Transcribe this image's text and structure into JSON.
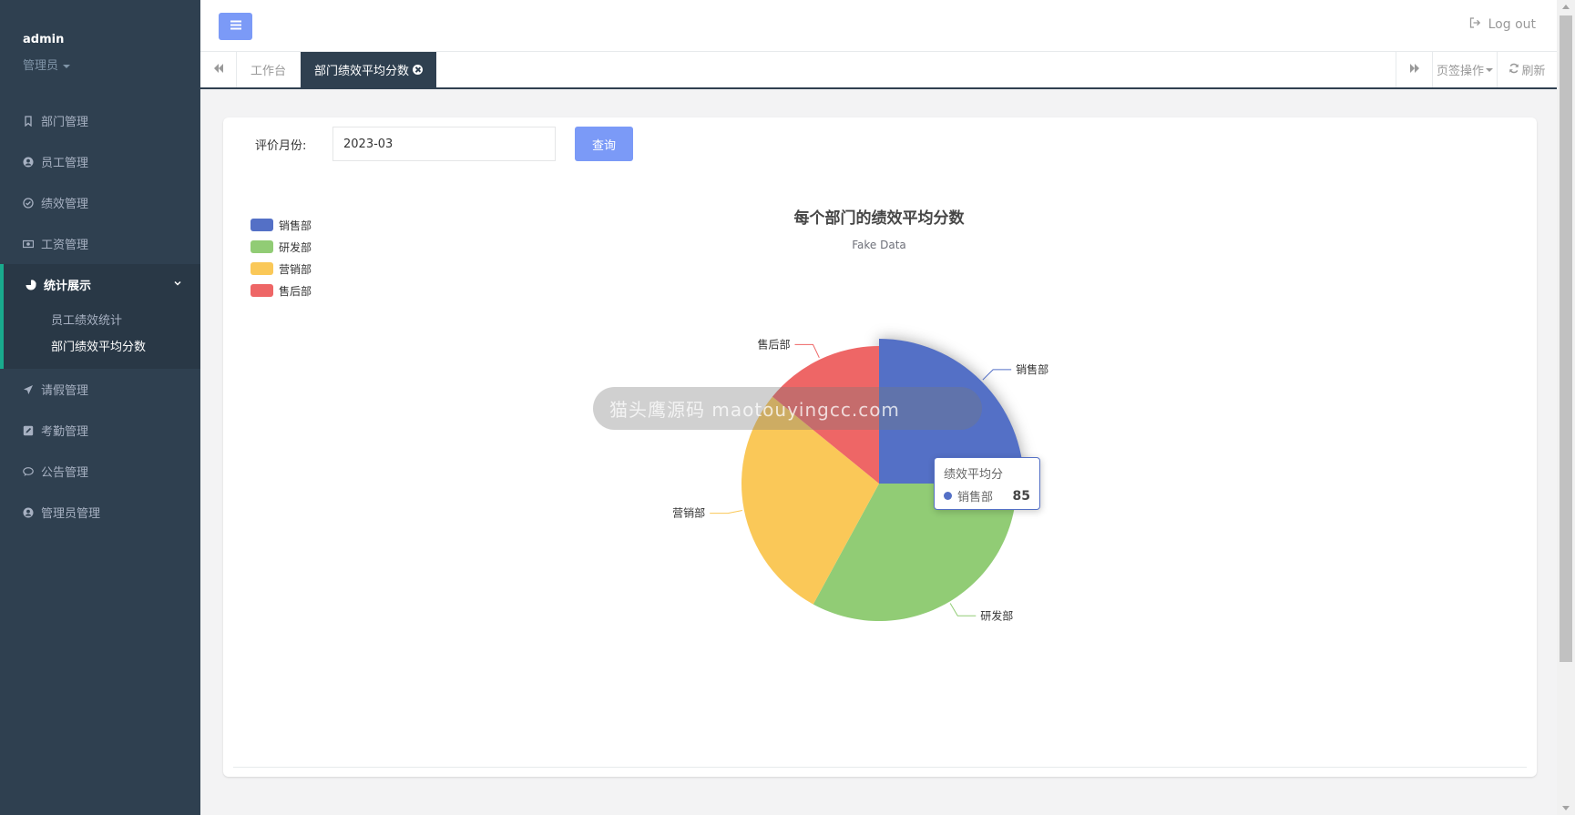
{
  "sidebar": {
    "user": {
      "name": "admin",
      "role": "管理员"
    },
    "items": [
      {
        "label": "部门管理",
        "icon": "bookmark-icon"
      },
      {
        "label": "员工管理",
        "icon": "user-circle-icon"
      },
      {
        "label": "绩效管理",
        "icon": "check-circle-icon"
      },
      {
        "label": "工资管理",
        "icon": "money-icon"
      },
      {
        "label": "统计展示",
        "icon": "pie-chart-icon"
      },
      {
        "label": "请假管理",
        "icon": "paper-plane-icon"
      },
      {
        "label": "考勤管理",
        "icon": "edit-icon"
      },
      {
        "label": "公告管理",
        "icon": "comment-icon"
      },
      {
        "label": "管理员管理",
        "icon": "user-circle-icon"
      }
    ],
    "subitems": [
      {
        "label": "员工绩效统计"
      },
      {
        "label": "部门绩效平均分数"
      }
    ]
  },
  "header": {
    "logout": "Log out"
  },
  "tabs": {
    "items": [
      {
        "label": "工作台"
      },
      {
        "label": "部门绩效平均分数"
      }
    ],
    "page_ops": "页签操作",
    "refresh": "刷新"
  },
  "filter": {
    "label": "评价月份:",
    "month_value": "2023-03",
    "query_button": "查询"
  },
  "watermark": "猫头鹰源码 maotouyingcc.com",
  "tooltip": {
    "title": "绩效平均分",
    "series": "销售部",
    "value": "85"
  },
  "colors": {
    "sidebar": "#2f4050",
    "accent": "#7b9af7",
    "active_border": "#19aa8d"
  },
  "chart_data": {
    "type": "pie",
    "title": "每个部门的绩效平均分数",
    "subtitle": "Fake Data",
    "legend_position": "top-left",
    "series_name": "绩效平均分",
    "slices": [
      {
        "name": "销售部",
        "value": 85,
        "color": "#5470c6"
      },
      {
        "name": "研发部",
        "value": 112,
        "color": "#91cc75"
      },
      {
        "name": "营销部",
        "value": 95,
        "color": "#fac858"
      },
      {
        "name": "售后部",
        "value": 48,
        "color": "#ee6666"
      }
    ]
  }
}
